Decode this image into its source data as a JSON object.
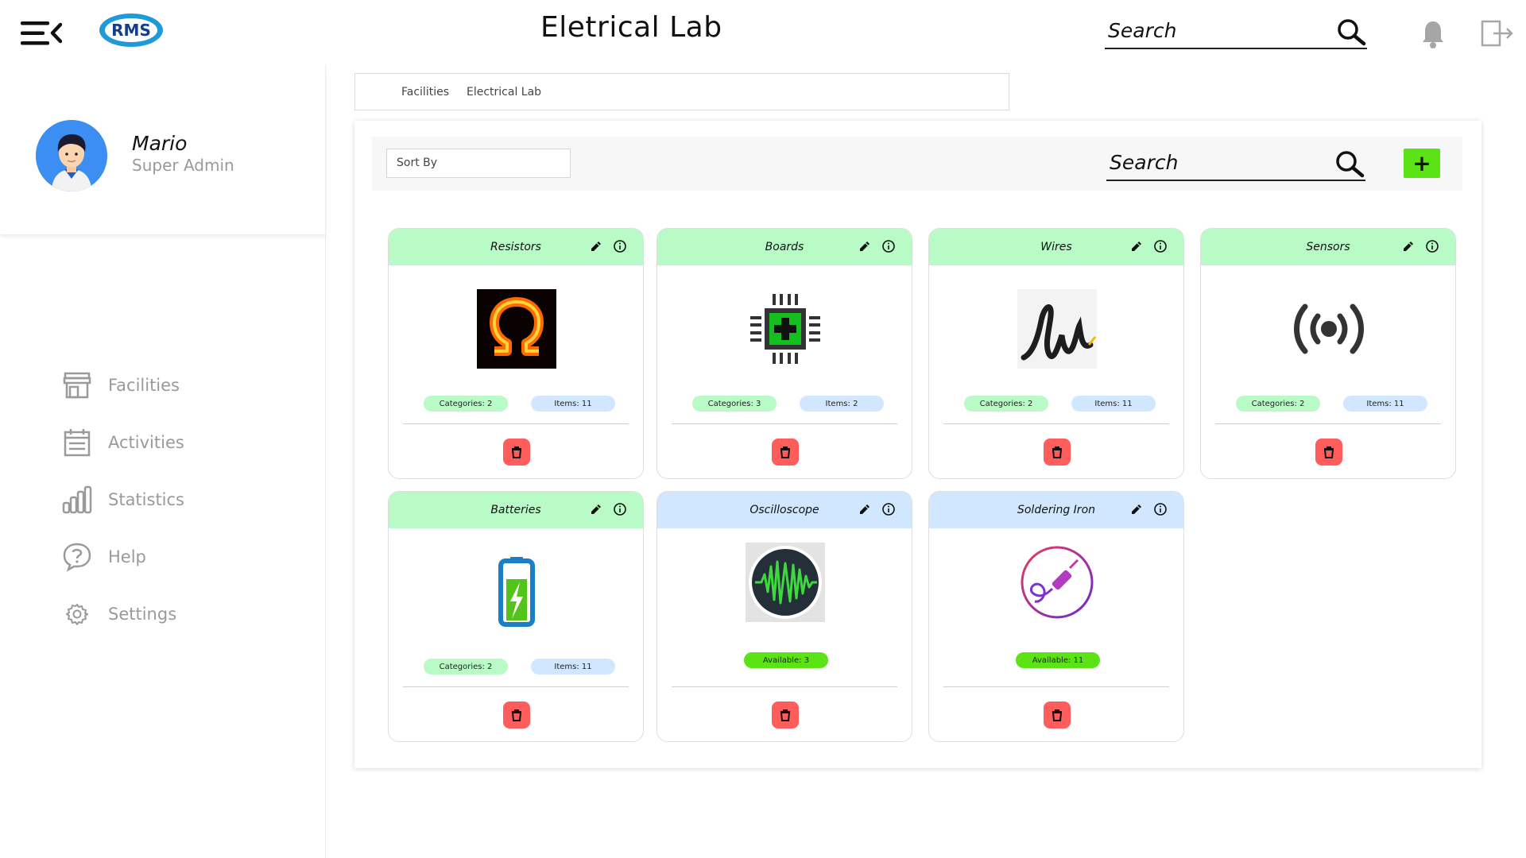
{
  "header": {
    "logo_text": "RMS",
    "title": "Eletrical Lab",
    "search_placeholder": "Search",
    "menu_icon": "menu-collapse-icon",
    "bell_icon": "bell-icon",
    "logout_icon": "logout-icon"
  },
  "profile": {
    "name": "Mario",
    "role": "Super Admin"
  },
  "sidebar": {
    "items": [
      {
        "label": "Facilities",
        "icon": "store-icon"
      },
      {
        "label": "Activities",
        "icon": "calendar-icon"
      },
      {
        "label": "Statistics",
        "icon": "bar-chart-icon"
      },
      {
        "label": "Help",
        "icon": "help-icon"
      },
      {
        "label": "Settings",
        "icon": "gear-icon"
      }
    ]
  },
  "breadcrumb": {
    "items": [
      "Facilities",
      "Electrical Lab"
    ]
  },
  "toolbar": {
    "sort_label": "Sort By",
    "search_placeholder": "Search",
    "add_label": "+"
  },
  "colors": {
    "header_green": "#b8fbc6",
    "header_blue": "#d1e7ff",
    "available_green": "#5ce316",
    "delete_red": "#ff5c5c"
  },
  "cards": [
    {
      "title": "Resistors",
      "image": "omega-icon",
      "categories": "Categories: 2",
      "items": "Items: 11"
    },
    {
      "title": "Boards",
      "image": "chip-icon",
      "categories": "Categories: 3",
      "items": "Items: 2"
    },
    {
      "title": "Wires",
      "image": "wire-icon",
      "categories": "Categories: 2",
      "items": "Items: 11"
    },
    {
      "title": "Sensors",
      "image": "sensor-icon",
      "categories": "Categories: 2",
      "items": "Items: 11"
    },
    {
      "title": "Batteries",
      "image": "battery-icon",
      "categories": "Categories: 2",
      "items": "Items: 11"
    },
    {
      "title": "Oscilloscope",
      "image": "oscilloscope-icon",
      "available": "Available: 3"
    },
    {
      "title": "Soldering Iron",
      "image": "soldering-iron-icon",
      "available": "Available: 11"
    }
  ]
}
